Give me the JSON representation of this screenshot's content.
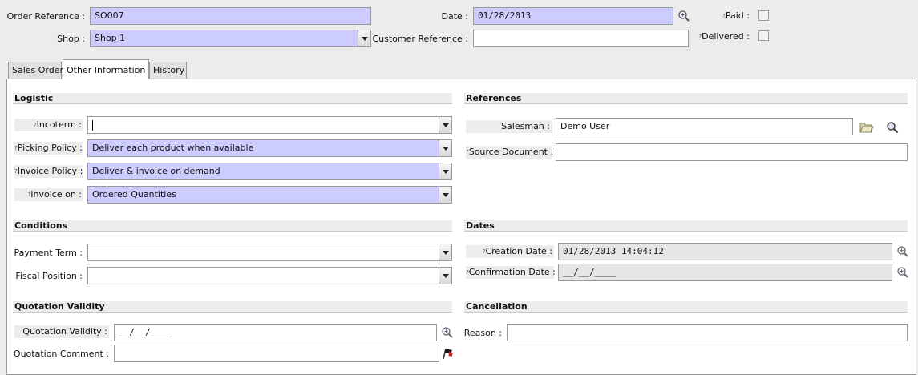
{
  "header": {
    "order_reference": {
      "label": "Order Reference :",
      "value": "SO007"
    },
    "shop": {
      "label": "Shop :",
      "value": "Shop 1"
    },
    "date": {
      "label": "Date :",
      "value": "01/28/2013"
    },
    "customer_reference": {
      "label": "Customer Reference :",
      "value": ""
    },
    "paid": {
      "label": "Paid :"
    },
    "delivered": {
      "label": "Delivered :"
    },
    "help_mark": "?"
  },
  "tabs": [
    {
      "label": "Sales Order"
    },
    {
      "label": "Other Information"
    },
    {
      "label": "History"
    }
  ],
  "logistic": {
    "title": "Logistic",
    "incoterm": {
      "label": "Incoterm :",
      "value": ""
    },
    "picking_policy": {
      "label": "Picking Policy :",
      "value": "Deliver each product when available"
    },
    "invoice_policy": {
      "label": "Invoice Policy :",
      "value": "Deliver & invoice on demand"
    },
    "invoice_on": {
      "label": "Invoice on :",
      "value": "Ordered Quantities"
    }
  },
  "references": {
    "title": "References",
    "salesman": {
      "label": "Salesman :",
      "value": "Demo User"
    },
    "source_document": {
      "label": "Source Document :",
      "value": ""
    }
  },
  "conditions": {
    "title": "Conditions",
    "payment_term": {
      "label": "Payment Term :",
      "value": ""
    },
    "fiscal_position": {
      "label": "Fiscal Position :",
      "value": ""
    }
  },
  "dates": {
    "title": "Dates",
    "creation_date": {
      "label": "Creation Date :",
      "value": "01/28/2013 14:04:12"
    },
    "confirmation_date": {
      "label": "Confirmation Date :",
      "value": "__/__/____"
    }
  },
  "quotation": {
    "title": "Quotation Validity",
    "validity": {
      "label": "Quotation Validity :",
      "value": "__/__/____"
    },
    "comment": {
      "label": "Quotation Comment :",
      "value": ""
    }
  },
  "cancellation": {
    "title": "Cancellation",
    "reason": {
      "label": "Reason :",
      "value": ""
    }
  }
}
